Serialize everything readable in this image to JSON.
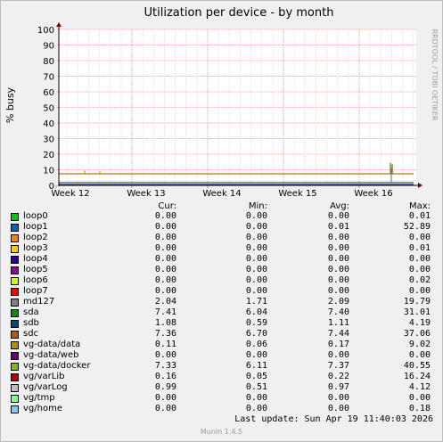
{
  "chart_data": {
    "type": "line",
    "title": "Utilization per device - by month",
    "ylabel": "% busy",
    "ylim": [
      0,
      100
    ],
    "yticks": [
      0,
      10,
      20,
      30,
      40,
      50,
      60,
      70,
      80,
      90,
      100
    ],
    "xticks": [
      "Week 12",
      "Week 13",
      "Week 14",
      "Week 15",
      "Week 16"
    ],
    "grid": true,
    "side_label": "RRDTOOL / TOBI OETIKER",
    "columns": [
      "Cur:",
      "Min:",
      "Avg:",
      "Max:"
    ],
    "series": [
      {
        "name": "loop0",
        "color": "#00cc00",
        "cur": "0.00",
        "min": "0.00",
        "avg": "0.00",
        "max": "0.01"
      },
      {
        "name": "loop1",
        "color": "#0066b3",
        "cur": "0.00",
        "min": "0.00",
        "avg": "0.01",
        "max": "52.89"
      },
      {
        "name": "loop2",
        "color": "#ff8000",
        "cur": "0.00",
        "min": "0.00",
        "avg": "0.00",
        "max": "0.00"
      },
      {
        "name": "loop3",
        "color": "#ffcc00",
        "cur": "0.00",
        "min": "0.00",
        "avg": "0.00",
        "max": "0.01"
      },
      {
        "name": "loop4",
        "color": "#330099",
        "cur": "0.00",
        "min": "0.00",
        "avg": "0.00",
        "max": "0.00"
      },
      {
        "name": "loop5",
        "color": "#990099",
        "cur": "0.00",
        "min": "0.00",
        "avg": "0.00",
        "max": "0.00"
      },
      {
        "name": "loop6",
        "color": "#ccff00",
        "cur": "0.00",
        "min": "0.00",
        "avg": "0.00",
        "max": "0.02"
      },
      {
        "name": "loop7",
        "color": "#ff0000",
        "cur": "0.00",
        "min": "0.00",
        "avg": "0.00",
        "max": "0.00"
      },
      {
        "name": "md127",
        "color": "#808080",
        "cur": "2.04",
        "min": "1.71",
        "avg": "2.09",
        "max": "19.79"
      },
      {
        "name": "sda",
        "color": "#008f00",
        "cur": "7.41",
        "min": "6.04",
        "avg": "7.40",
        "max": "31.01"
      },
      {
        "name": "sdb",
        "color": "#00487d",
        "cur": "1.08",
        "min": "0.59",
        "avg": "1.11",
        "max": "4.19"
      },
      {
        "name": "sdc",
        "color": "#b35a00",
        "cur": "7.36",
        "min": "6.70",
        "avg": "7.44",
        "max": "37.06"
      },
      {
        "name": "vg-data/data",
        "color": "#b38f00",
        "cur": "0.11",
        "min": "0.06",
        "avg": "0.17",
        "max": "9.02"
      },
      {
        "name": "vg-data/web",
        "color": "#6b006b",
        "cur": "0.00",
        "min": "0.00",
        "avg": "0.00",
        "max": "0.00"
      },
      {
        "name": "vg-data/docker",
        "color": "#8fb300",
        "cur": "7.33",
        "min": "6.11",
        "avg": "7.37",
        "max": "40.55"
      },
      {
        "name": "vg/varLib",
        "color": "#b30000",
        "cur": "0.16",
        "min": "0.05",
        "avg": "0.22",
        "max": "16.24"
      },
      {
        "name": "vg/varLog",
        "color": "#bebebe",
        "cur": "0.99",
        "min": "0.51",
        "avg": "0.97",
        "max": "4.12"
      },
      {
        "name": "vg/tmp",
        "color": "#80ff80",
        "cur": "0.00",
        "min": "0.00",
        "avg": "0.00",
        "max": "0.00"
      },
      {
        "name": "vg/home",
        "color": "#80c9ff",
        "cur": "0.00",
        "min": "0.00",
        "avg": "0.00",
        "max": "0.18"
      }
    ]
  },
  "footer": {
    "last_update": "Last update:  Sun Apr 19 11:40:03 2026",
    "version": "Munin 1.4.5"
  }
}
